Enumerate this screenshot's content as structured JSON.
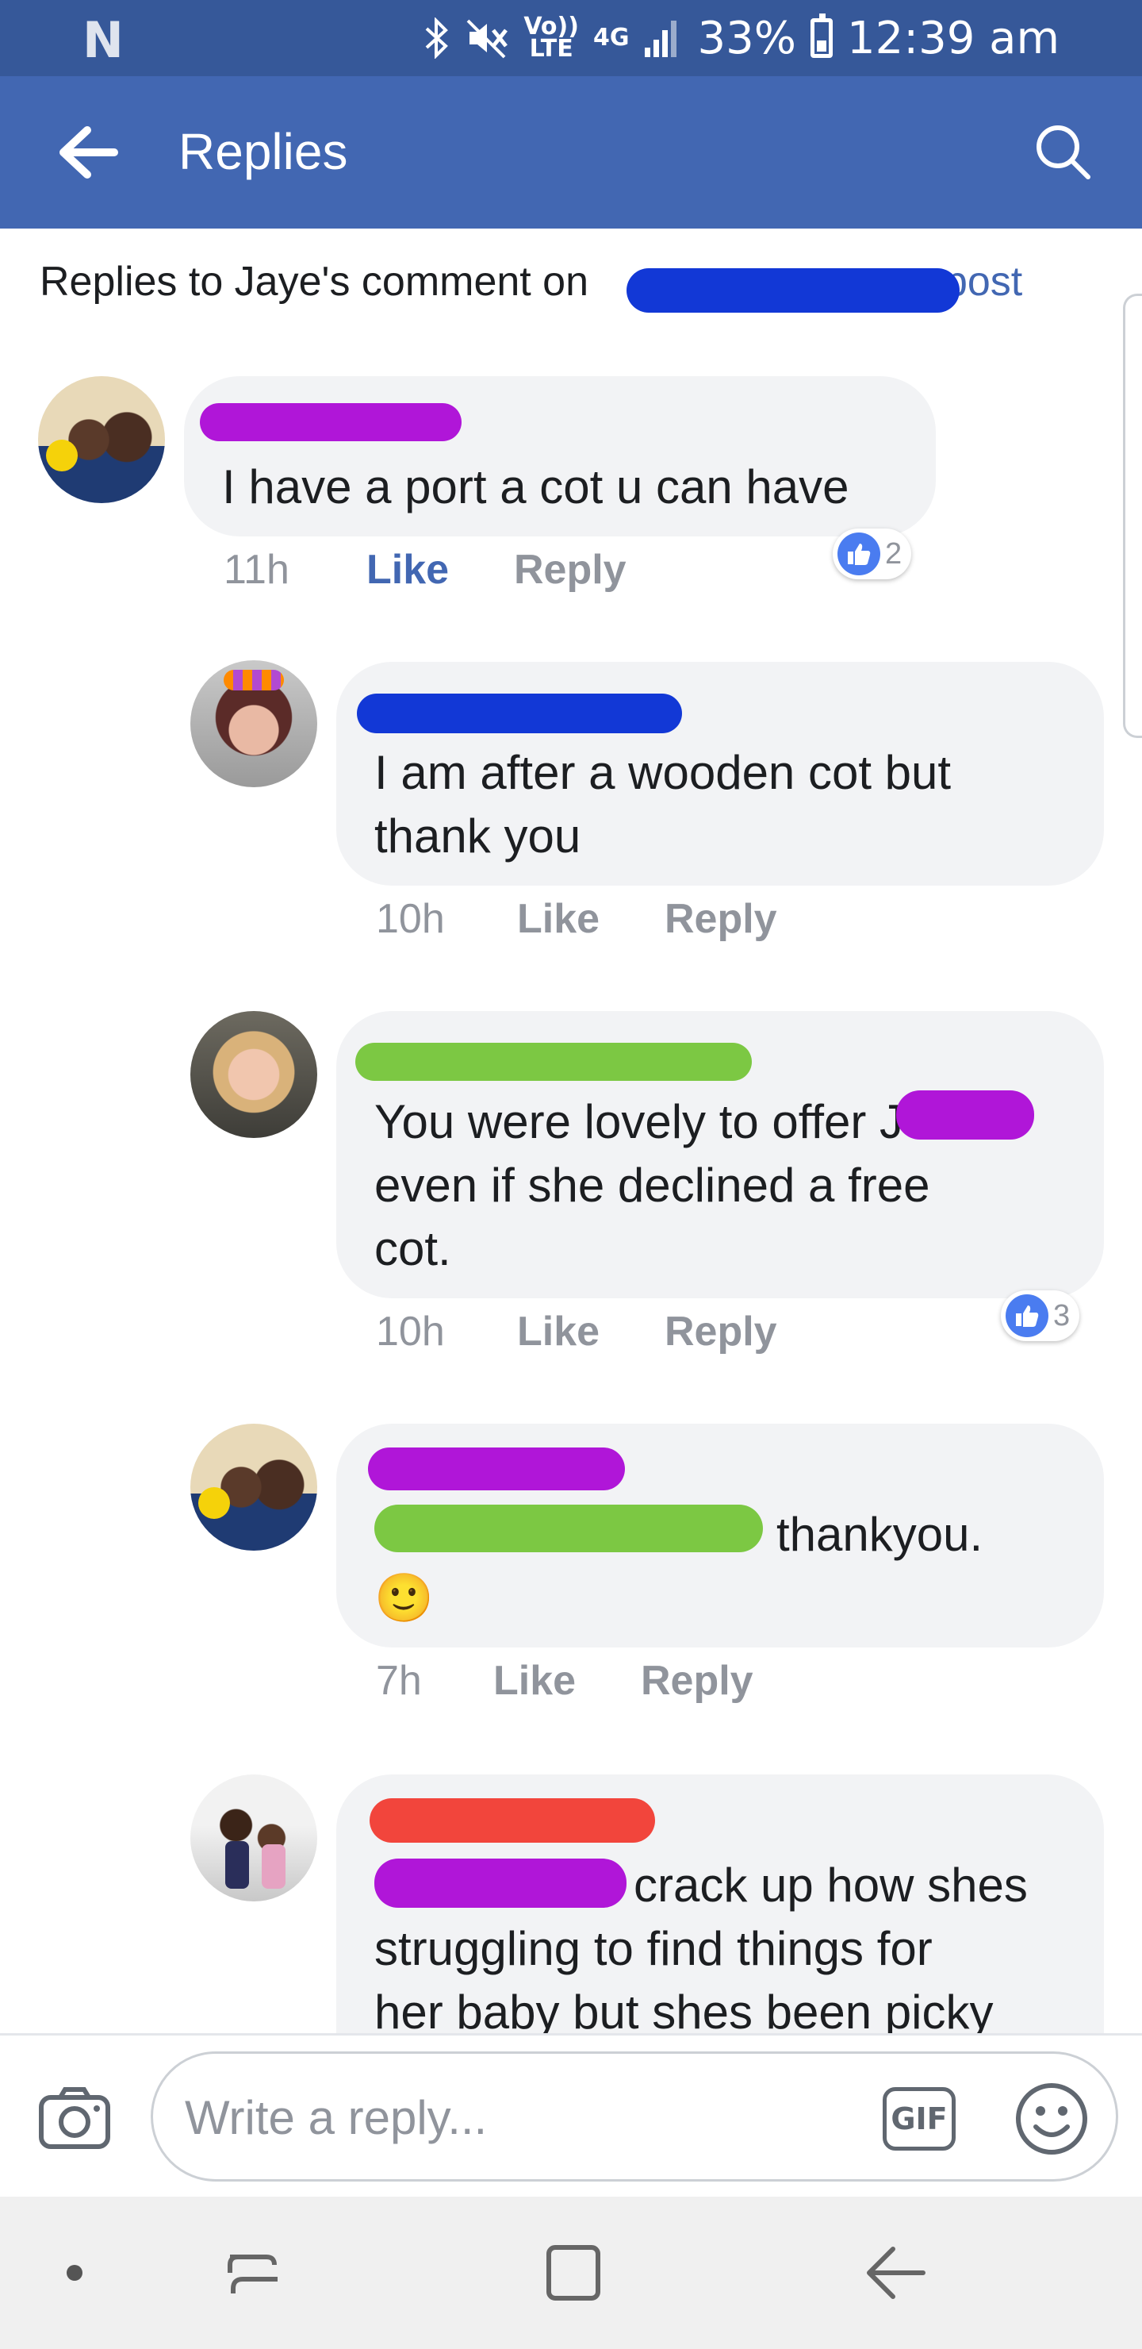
{
  "status_bar": {
    "carrier_logo": "N",
    "volte_top": "Vo))",
    "volte_bottom": "LTE",
    "network": "4G",
    "battery": "33%",
    "time": "12:39 am"
  },
  "header": {
    "title": "Replies",
    "back_icon": "back-arrow-icon",
    "search_icon": "search-icon"
  },
  "context": {
    "prefix": "Replies to Jaye's comment on",
    "link_suffix": "post"
  },
  "comments": [
    {
      "text": "I have a port a cot u can have",
      "time": "11h",
      "like": "Like",
      "reply": "Reply",
      "like_active": true,
      "reactions": "2",
      "scribble_color": "#b016d8"
    },
    {
      "text_lines": [
        "I am after a wooden cot but",
        "thank you"
      ],
      "time": "10h",
      "like": "Like",
      "reply": "Reply",
      "scribble_color": "#1238d6"
    },
    {
      "text_lines": [
        "You were lovely to offer J",
        "even if she declined a free",
        "cot."
      ],
      "time": "10h",
      "like": "Like",
      "reply": "Reply",
      "reactions": "3",
      "scribble_color": "#7cc843"
    },
    {
      "text_lines": [
        "thankyou."
      ],
      "emoji": "🙂",
      "time": "7h",
      "like": "Like",
      "reply": "Reply",
      "scribble_color": "#b016d8"
    },
    {
      "text_lines": [
        "crack up how shes",
        "struggling  to find things for",
        "her baby but shes been picky"
      ],
      "scribble_color": "#f2453c"
    }
  ],
  "composer": {
    "placeholder": "Write a reply...",
    "gif_label": "GIF"
  },
  "colors": {
    "facebook_blue": "#4267b2",
    "status_bar": "#365899",
    "bubble": "#f2f3f5"
  }
}
